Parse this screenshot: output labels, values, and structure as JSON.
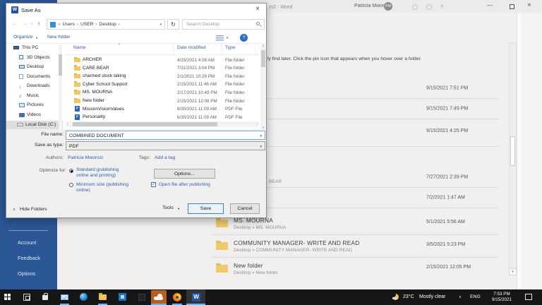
{
  "word": {
    "window_title_fragment": "m2 - Word",
    "titlebar": {
      "user_name": "Patricia Mworozi",
      "avatar_initials": "PM",
      "help_glyph": "?",
      "minimize_glyph": "—",
      "close_glyph": "×"
    },
    "hint_fragment": "ly find later. Click the pin icon that appears when you hover over a folder.",
    "rows": [
      {
        "date": "9/15/2021 7:51 PM"
      },
      {
        "date": "9/15/2021 7:49 PM"
      },
      {
        "date": "9/15/2021 4:25 PM"
      },
      {
        "date": "7/27/2021 2:39 PM",
        "subtitle_fragment": "BEAR"
      },
      {
        "date": "7/2/2021 1:47 AM"
      },
      {
        "name": "MS. MOURNA",
        "subtitle": "Desktop » MS. MOURNA",
        "date": "5/1/2021 5:56 AM"
      },
      {
        "name": "COMMUNITY MANAGER- WRITE AND READ",
        "subtitle": "Desktop » COMMUNITY MANAGER- WRITE AND READ",
        "date": "3/5/2021 5:23 PM"
      },
      {
        "name": "New folder",
        "subtitle": "Desktop » New folder",
        "date": "2/15/2021 12:05 PM"
      }
    ],
    "sidebar_items": [
      "Account",
      "Feedback",
      "Options"
    ],
    "scroll_down_glyph": "▾"
  },
  "dialog": {
    "title": "Save As",
    "app_icon_letter": "W",
    "close_glyph": "×",
    "nav": {
      "back": "←",
      "forward": "→",
      "up": "↑",
      "refresh": "↻",
      "dropdown": "▾"
    },
    "breadcrumb": {
      "prefix": "«",
      "separator": "›",
      "segments": [
        "Users",
        "USER",
        "Desktop"
      ]
    },
    "search": {
      "placeholder": "Search Desktop"
    },
    "toolbar": {
      "organize": "Organize",
      "new_folder": "New folder",
      "help_glyph": "?"
    },
    "sidebar": [
      "This PC",
      "3D Objects",
      "Desktop",
      "Documents",
      "Downloads",
      "Music",
      "Pictures",
      "Videos",
      "Local Disk (C:)"
    ],
    "columns": {
      "name": "Name",
      "date": "Date modified",
      "type": "Type",
      "sort_glyph": "∧"
    },
    "files": [
      {
        "name": "ARCHER",
        "date": "4/15/2021 4:08 AM",
        "type": "File folder"
      },
      {
        "name": "CARE BEAR",
        "date": "7/31/2021 3:04 PM",
        "type": "File folder"
      },
      {
        "name": "charmed stock taking",
        "date": "2/1/2021 10:29 PM",
        "type": "File folder"
      },
      {
        "name": "Cyber School Support",
        "date": "2/15/2021 11:46 AM",
        "type": "File folder"
      },
      {
        "name": "MS. MOURNA",
        "date": "2/17/2021 10:49 PM",
        "type": "File folder"
      },
      {
        "name": "New folder",
        "date": "2/15/2021 12:08 PM",
        "type": "File folder"
      },
      {
        "name": "MissionVisionValues",
        "date": "6/30/2021 11:09 AM",
        "type": "PDF File"
      },
      {
        "name": "Personality",
        "date": "6/30/2021 11:09 AM",
        "type": "PDF File"
      }
    ],
    "pdf_icon_letter": "P",
    "fields": {
      "file_name_label": "File name:",
      "file_name_value": "COMBINED DOCUMENT",
      "save_type_label": "Save as type:",
      "save_type_value": "PDF",
      "authors_label": "Authors:",
      "authors_value": "Patricia Mworozi",
      "tags_label": "Tags:",
      "tags_value": "Add a tag"
    },
    "optimize": {
      "label": "Optimize for:",
      "standard": "Standard (publishing online and printing)",
      "minimum": "Minimum size (publishing online)"
    },
    "buttons": {
      "options": "Options...",
      "open_after": "Open file after publishing",
      "check_glyph": "✓",
      "tools": "Tools",
      "save": "Save",
      "cancel": "Cancel"
    },
    "footer": {
      "hide_folders": "Hide Folders",
      "collapse_glyph": "∧"
    },
    "scroll": {
      "up": "∧",
      "down": "∨",
      "left": "‹",
      "right": "›"
    }
  },
  "taskbar": {
    "tray": {
      "temp": "23°C",
      "condition": "Mostly clear",
      "chevron": "∧",
      "lang": "ENG",
      "time": "7:53 PM",
      "date": "9/15/2021"
    }
  }
}
